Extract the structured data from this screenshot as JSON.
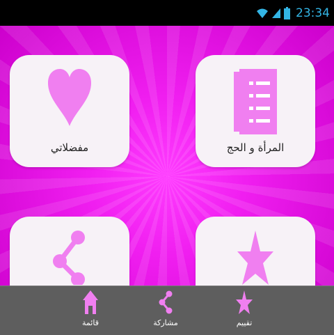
{
  "status_bar": {
    "time": "23:34"
  },
  "colors": {
    "accent": "#f07ff0",
    "background": "#e00fe0",
    "tile": "#f7f2f7",
    "nav_bar": "#5e5e5e",
    "clock": "#33b5e5"
  },
  "tiles": [
    {
      "label": "المرأة و الحج",
      "icon": "document-icon"
    },
    {
      "label": "مفضلاتي",
      "icon": "heart-icon"
    },
    {
      "label": "",
      "icon": "star-icon"
    },
    {
      "label": "",
      "icon": "share-icon"
    }
  ],
  "bottom_nav": [
    {
      "label": "تقييم",
      "icon": "star-icon"
    },
    {
      "label": "مشاركة",
      "icon": "share-icon"
    },
    {
      "label": "قائمة",
      "icon": "home-icon"
    }
  ]
}
